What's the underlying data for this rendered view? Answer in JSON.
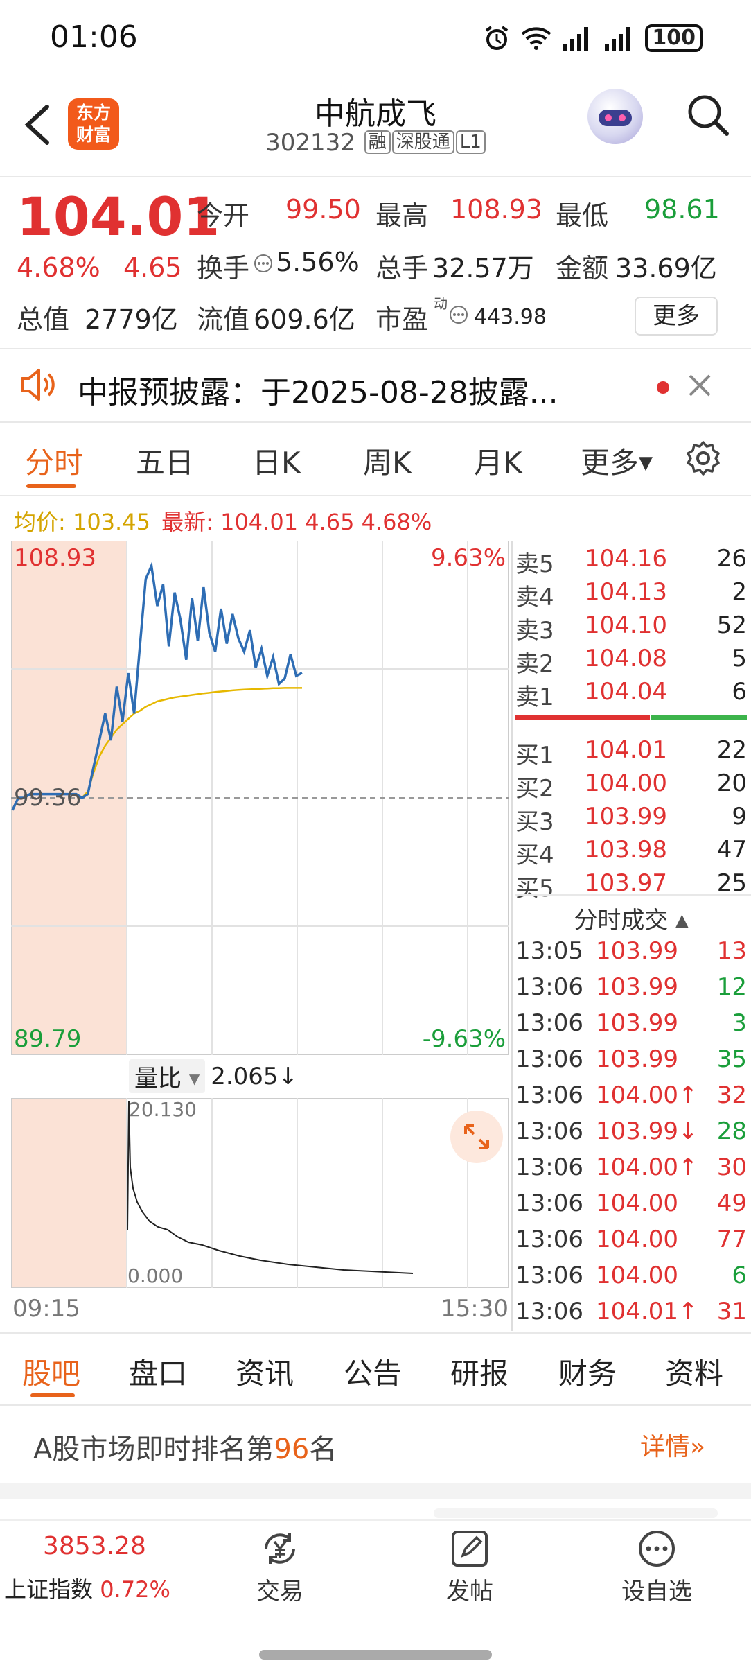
{
  "status_bar": {
    "time": "01:06",
    "battery": "100"
  },
  "header": {
    "logo_line1": "东方",
    "logo_line2": "财富",
    "stock_name": "中航成飞",
    "stock_code": "302132",
    "tags": [
      "融",
      "深股通",
      "L1"
    ]
  },
  "quote": {
    "price": "104.01",
    "change_pct": "4.68%",
    "change_amt": "4.65",
    "open_label": "今开",
    "open": "99.50",
    "high_label": "最高",
    "high": "108.93",
    "low_label": "最低",
    "low": "98.61",
    "turnover_label": "换手",
    "turnover": "5.56%",
    "volume_label": "总手",
    "volume": "32.57万",
    "amount_label": "金额",
    "amount": "33.69亿",
    "mktcap_label": "总值",
    "mktcap": "2779亿",
    "float_label": "流值",
    "float_cap": "609.6亿",
    "pe_label": "市盈",
    "pe_sup": "动",
    "pe": "443.98",
    "more_label": "更多"
  },
  "notice": {
    "text": "中报预披露：于2025-08-28披露..."
  },
  "chart_tabs": [
    "分时",
    "五日",
    "日K",
    "周K",
    "月K",
    "更多"
  ],
  "legend": {
    "avg_label": "均价:",
    "avg": "103.45",
    "latest_label": "最新:",
    "latest": "104.01",
    "latest_chg": "4.65",
    "latest_pct": "4.68%"
  },
  "chart_labels": {
    "top_price": "108.93",
    "bottom_price": "89.79",
    "mid_price": "99.36",
    "top_pct": "9.63%",
    "bottom_pct": "-9.63%",
    "vol_label": "量比",
    "vol_value": "2.065↓",
    "vol_top": "20.130",
    "vol_bottom": "0.000",
    "time_start": "09:15",
    "time_end": "15:30"
  },
  "colors": {
    "accent": "#e8631b",
    "up": "#e03131",
    "down": "#1a9e3a",
    "price_line": "#2e6db4",
    "avg_line": "#e6b800"
  },
  "chart_data": {
    "type": "line",
    "title": "",
    "ylim": [
      89.79,
      108.93
    ],
    "prev_close": 99.36,
    "series": [
      {
        "values": [
          98.9,
          99.36,
          99.36,
          99.5,
          99.5,
          99.5,
          99.5,
          99.5,
          99.5,
          99.5,
          99.5,
          99.5,
          99.36,
          99.5,
          100.5,
          101.5,
          102.5,
          101.5,
          103.5,
          102.2,
          104.0,
          102.5,
          105.0,
          107.5,
          108.0,
          106.5,
          107.3,
          105.0,
          107.0,
          106.0,
          104.5,
          106.8,
          105.2,
          107.2,
          105.5,
          104.8,
          106.4,
          105.1,
          106.2,
          105.3,
          104.8,
          105.6,
          104.2,
          104.9,
          103.9,
          104.6,
          103.6,
          103.8,
          104.7,
          103.9,
          104.01
        ]
      },
      {
        "values": [
          null,
          null,
          null,
          null,
          null,
          null,
          null,
          null,
          null,
          null,
          null,
          null,
          99.36,
          99.6,
          100.3,
          100.9,
          101.3,
          101.6,
          101.9,
          102.1,
          102.3,
          102.5,
          102.6,
          102.75,
          102.85,
          102.95,
          103.0,
          103.05,
          103.1,
          103.13,
          103.16,
          103.19,
          103.22,
          103.25,
          103.27,
          103.3,
          103.32,
          103.34,
          103.36,
          103.38,
          103.39,
          103.4,
          103.41,
          103.42,
          103.43,
          103.44,
          103.44,
          103.45,
          103.45,
          103.45,
          103.45
        ]
      }
    ]
  },
  "order_book": {
    "asks": [
      {
        "label": "卖5",
        "price": "104.16",
        "vol": "26"
      },
      {
        "label": "卖4",
        "price": "104.13",
        "vol": "2"
      },
      {
        "label": "卖3",
        "price": "104.10",
        "vol": "52"
      },
      {
        "label": "卖2",
        "price": "104.08",
        "vol": "5"
      },
      {
        "label": "卖1",
        "price": "104.04",
        "vol": "6"
      }
    ],
    "bids": [
      {
        "label": "买1",
        "price": "104.01",
        "vol": "22"
      },
      {
        "label": "买2",
        "price": "104.00",
        "vol": "20"
      },
      {
        "label": "买3",
        "price": "103.99",
        "vol": "9"
      },
      {
        "label": "买4",
        "price": "103.98",
        "vol": "47"
      },
      {
        "label": "买5",
        "price": "103.97",
        "vol": "25"
      }
    ]
  },
  "trades": {
    "title": "分时成交",
    "rows": [
      {
        "time": "13:05",
        "price": "103.99",
        "vol": "13",
        "dir": "sell"
      },
      {
        "time": "13:06",
        "price": "103.99",
        "vol": "12",
        "dir": "buy"
      },
      {
        "time": "13:06",
        "price": "103.99",
        "vol": "3",
        "dir": "buy"
      },
      {
        "time": "13:06",
        "price": "103.99",
        "vol": "35",
        "dir": "buy"
      },
      {
        "time": "13:06",
        "price": "104.00↑",
        "vol": "32",
        "dir": "sell"
      },
      {
        "time": "13:06",
        "price": "103.99↓",
        "vol": "28",
        "dir": "buy"
      },
      {
        "time": "13:06",
        "price": "104.00↑",
        "vol": "30",
        "dir": "sell"
      },
      {
        "time": "13:06",
        "price": "104.00",
        "vol": "49",
        "dir": "sell"
      },
      {
        "time": "13:06",
        "price": "104.00",
        "vol": "77",
        "dir": "sell"
      },
      {
        "time": "13:06",
        "price": "104.00",
        "vol": "6",
        "dir": "buy"
      },
      {
        "time": "13:06",
        "price": "104.01↑",
        "vol": "31",
        "dir": "sell"
      }
    ]
  },
  "bottom_tabs": [
    "股吧",
    "盘口",
    "资讯",
    "公告",
    "研报",
    "财务",
    "资料"
  ],
  "ranking": {
    "prefix": "A股市场即时排名第",
    "rank": "96",
    "suffix": "名",
    "detail": "详情"
  },
  "bottom_nav": {
    "index_price": "3853.28",
    "index_name": "上证指数",
    "index_pct": "0.72%",
    "trade": "交易",
    "post": "发帖",
    "watch": "设自选"
  }
}
